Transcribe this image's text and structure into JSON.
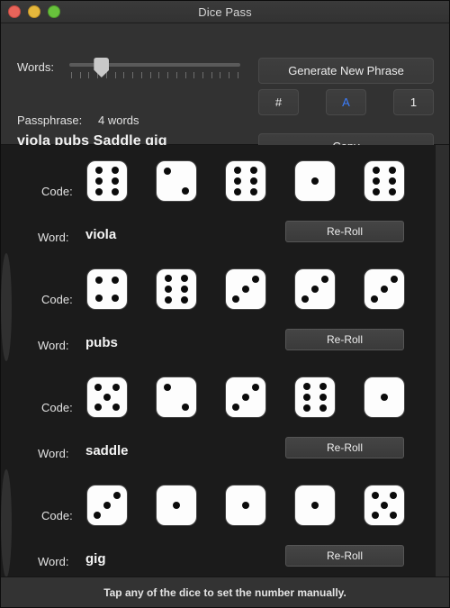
{
  "window": {
    "title": "Dice Pass",
    "traffic_lights": [
      {
        "name": "close-button",
        "color": "#e8645a"
      },
      {
        "name": "minimize-button",
        "color": "#e5b73c"
      },
      {
        "name": "maximize-button",
        "color": "#68c13c"
      }
    ]
  },
  "controls": {
    "words_label": "Words:",
    "slider": {
      "min": 1,
      "max": 20,
      "value": 4,
      "tick_count": 20
    },
    "passphrase_label": "Passphrase:",
    "passphrase_count": "4 words",
    "passphrase_value": "viola pubs Saddle gig",
    "generate_label": "Generate New Phrase",
    "copy_label": "Copy",
    "toggles": [
      {
        "name": "hash-toggle",
        "label": "#",
        "active": false
      },
      {
        "name": "alpha-toggle",
        "label": "A",
        "active": true
      },
      {
        "name": "number-toggle",
        "label": "1",
        "active": false
      }
    ],
    "accent_color": "#3b7dfc"
  },
  "rows": [
    {
      "code_label": "Code:",
      "word_label": "Word:",
      "word": "viola",
      "dice": [
        6,
        2,
        6,
        1,
        6
      ],
      "reroll_label": "Re-Roll"
    },
    {
      "code_label": "Code:",
      "word_label": "Word:",
      "word": "pubs",
      "dice": [
        4,
        6,
        3,
        3,
        3
      ],
      "reroll_label": "Re-Roll"
    },
    {
      "code_label": "Code:",
      "word_label": "Word:",
      "word": "saddle",
      "dice": [
        5,
        2,
        3,
        6,
        1
      ],
      "reroll_label": "Re-Roll"
    },
    {
      "code_label": "Code:",
      "word_label": "Word:",
      "word": "gig",
      "dice": [
        3,
        1,
        1,
        1,
        5
      ],
      "reroll_label": "Re-Roll"
    }
  ],
  "footer": {
    "hint": "Tap any of the dice to set the number manually."
  }
}
